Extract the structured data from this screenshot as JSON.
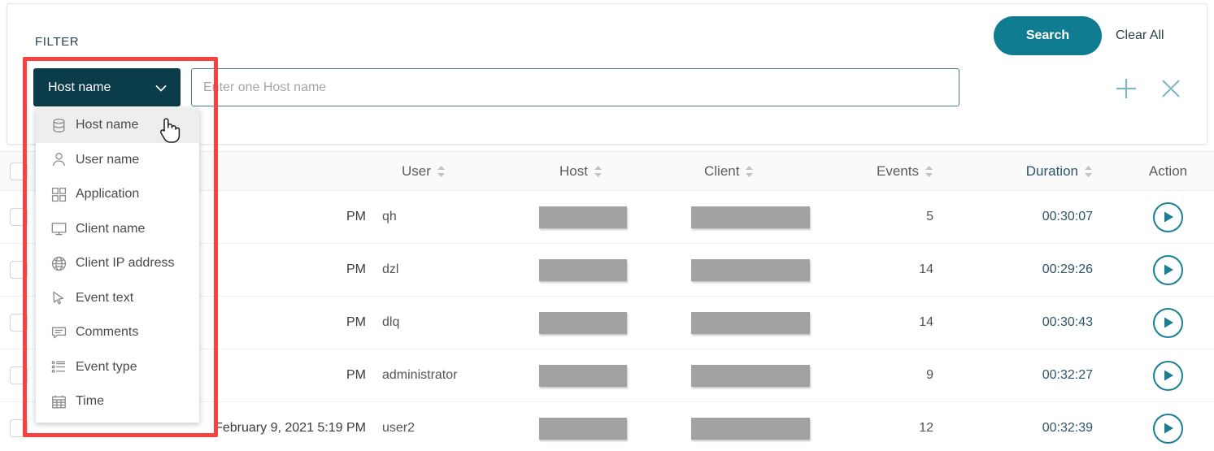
{
  "filter": {
    "title": "FILTER",
    "search_label": "Search",
    "clear_all_label": "Clear All",
    "selected_field": "Host name",
    "input_value": "",
    "input_placeholder": "Enter one Host name",
    "add_icon": "plus-icon",
    "remove_icon": "close-icon",
    "chevron_icon": "chevron-down-icon",
    "accent_color": "#0f7c91",
    "select_color": "#0b3c4a",
    "annotation_color": "#f8423f"
  },
  "dropdown": {
    "items": [
      {
        "label": "Host name",
        "icon": "database-icon",
        "active": true
      },
      {
        "label": "User name",
        "icon": "user-icon",
        "active": false
      },
      {
        "label": "Application",
        "icon": "grid-icon",
        "active": false
      },
      {
        "label": "Client name",
        "icon": "monitor-icon",
        "active": false
      },
      {
        "label": "Client IP address",
        "icon": "globe-icon",
        "active": false
      },
      {
        "label": "Event text",
        "icon": "cursor-icon",
        "active": false
      },
      {
        "label": "Comments",
        "icon": "comment-icon",
        "active": false
      },
      {
        "label": "Event type",
        "icon": "list-icon",
        "active": false
      },
      {
        "label": "Time",
        "icon": "calendar-icon",
        "active": false
      }
    ]
  },
  "table": {
    "columns": [
      {
        "key": "date",
        "label": "",
        "sortable": false
      },
      {
        "key": "user",
        "label": "User",
        "sortable": true
      },
      {
        "key": "host",
        "label": "Host",
        "sortable": true
      },
      {
        "key": "client",
        "label": "Client",
        "sortable": true
      },
      {
        "key": "events",
        "label": "Events",
        "sortable": true
      },
      {
        "key": "dur",
        "label": "Duration",
        "sortable": true
      },
      {
        "key": "action",
        "label": "Action",
        "sortable": false
      }
    ],
    "rows": [
      {
        "date": "PM",
        "user": "qh",
        "host": "redacted",
        "client": "redacted",
        "events": "5",
        "duration": "00:30:07",
        "action": "play-icon"
      },
      {
        "date": "PM",
        "user": "dzl",
        "host": "redacted",
        "client": "redacted",
        "events": "14",
        "duration": "00:29:26",
        "action": "play-icon"
      },
      {
        "date": "PM",
        "user": "dlq",
        "host": "redacted",
        "client": "redacted",
        "events": "14",
        "duration": "00:30:43",
        "action": "play-icon"
      },
      {
        "date": "PM",
        "user": "administrator",
        "host": "redacted",
        "client": "redacted",
        "events": "9",
        "duration": "00:32:27",
        "action": "play-icon"
      },
      {
        "date": "February 9, 2021 5:19 PM",
        "user": "user2",
        "host": "redacted",
        "client": "redacted",
        "events": "12",
        "duration": "00:32:39",
        "action": "play-icon"
      }
    ]
  }
}
